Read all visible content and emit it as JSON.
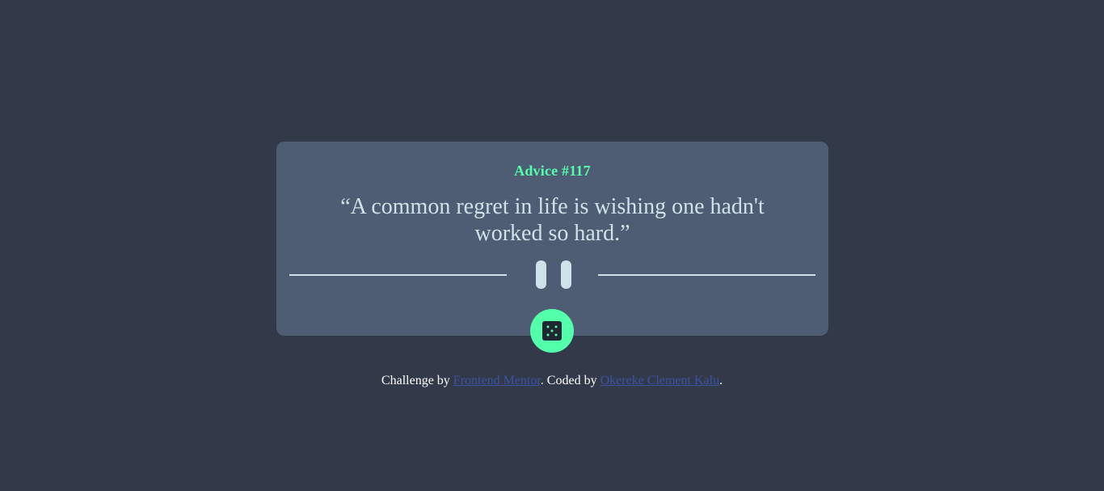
{
  "advice": {
    "title": "Advice #117",
    "quote": "“A common regret in life is wishing one hadn't worked so hard.”"
  },
  "dice_button": {
    "icon": "dice-icon"
  },
  "divider": {
    "icon": "pause-icon"
  },
  "attribution": {
    "prefix": "Challenge by ",
    "link1": "Frontend Mentor",
    "middle": ". Coded by ",
    "link2": "Okereke Clement Kalu",
    "suffix": "."
  },
  "colors": {
    "background": "#323a49",
    "card": "#4e5d73",
    "accent": "#53ffaa",
    "text": "#cee3e9",
    "link": "#3e52a3"
  }
}
